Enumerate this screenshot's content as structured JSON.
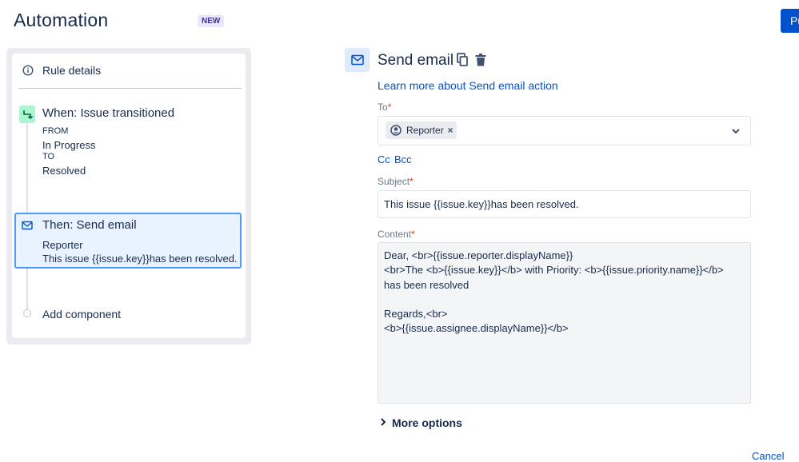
{
  "header": {
    "title": "Automation",
    "badge": "NEW",
    "publish_label": "Publish"
  },
  "rule_panel": {
    "rule_details_label": "Rule details",
    "trigger": {
      "title": "When: Issue transitioned",
      "from_label": "FROM",
      "from_value": "In Progress",
      "to_label": "TO",
      "to_value": "Resolved"
    },
    "action": {
      "title": "Then: Send email",
      "line1": "Reporter",
      "line2": "This issue {{issue.key}}has been resolved."
    },
    "add_component_label": "Add component"
  },
  "config": {
    "title": "Send email",
    "learn_more_link": "Learn more about Send email action",
    "to_label": "To",
    "required_mark": "*",
    "to_chip": "Reporter",
    "chip_remove": "×",
    "cc_label": "Cc",
    "bcc_label": "Bcc",
    "subject_label": "Subject",
    "subject_value": "This issue {{issue.key}}has been resolved.",
    "content_label": "Content",
    "content_value": "Dear, <br>{{issue.reporter.displayName}}\n<br>The <b>{{issue.key}}</b> with Priority: <b>{{issue.priority.name}}</b>\nhas been resolved\n\nRegards,<br>\n<b>{{issue.assignee.displayName}}</b>",
    "more_options_label": "More options",
    "cancel_label": "Cancel"
  },
  "colors": {
    "brand": "#0052cc",
    "link": "#0052cc",
    "selected_border": "#4c9aff",
    "selected_bg": "#e9f2ff",
    "trigger_icon_bg": "#abf5d1",
    "required": "#de350b"
  },
  "icons": [
    "info-icon",
    "trigger-branch-icon",
    "mail-icon",
    "copy-icon",
    "trash-icon",
    "avatar-icon",
    "chevron-down-icon",
    "chevron-right-icon"
  ]
}
